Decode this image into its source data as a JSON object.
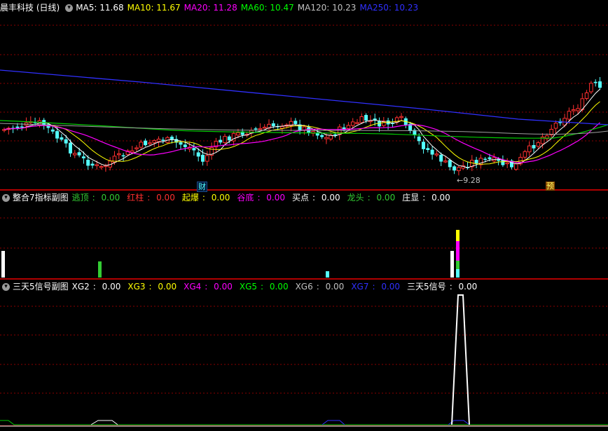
{
  "main": {
    "title": "晨丰科技 (日线)",
    "ma": [
      {
        "label": "MA5: 11.68",
        "color": "#ffffff"
      },
      {
        "label": "MA10: 11.67",
        "color": "#ffff00"
      },
      {
        "label": "MA20: 11.28",
        "color": "#ff00ff"
      },
      {
        "label": "MA60: 10.47",
        "color": "#00ff00"
      },
      {
        "label": "MA120: 10.23",
        "color": "#c0c0c0"
      },
      {
        "label": "MA250: 10.23",
        "color": "#3030ff"
      }
    ],
    "low_marker": "9.28",
    "badges": {
      "cai": "财",
      "yu": "预"
    },
    "colors": {
      "up": "#ff3030",
      "down": "#54ffff",
      "grid": "#8b0000",
      "border": "#b00000"
    }
  },
  "sub1": {
    "title": "整合7指标副图",
    "items": [
      {
        "name": "逃顶",
        "value": "0.00",
        "color": "#33cc33"
      },
      {
        "name": "红柱",
        "value": "0.00",
        "color": "#ff3030"
      },
      {
        "name": "起爆",
        "value": "0.00",
        "color": "#ffff00"
      },
      {
        "name": "谷底",
        "value": "0.00",
        "color": "#ff00ff"
      },
      {
        "name": "买点",
        "value": "0.00",
        "color": "#ffffff"
      },
      {
        "name": "龙头",
        "value": "0.00",
        "color": "#33cc33"
      },
      {
        "name": "庄显",
        "value": "0.00",
        "color": "#ffffff"
      }
    ]
  },
  "sub2": {
    "title": "三天5信号副图",
    "items": [
      {
        "name": "XG2",
        "value": "0.00",
        "color": "#ffffff"
      },
      {
        "name": "XG3",
        "value": "0.00",
        "color": "#ffff00"
      },
      {
        "name": "XG4",
        "value": "0.00",
        "color": "#ff00ff"
      },
      {
        "name": "XG5",
        "value": "0.00",
        "color": "#00ff00"
      },
      {
        "name": "XG6",
        "value": "0.00",
        "color": "#c0c0c0"
      },
      {
        "name": "XG7",
        "value": "0.00",
        "color": "#3030ff"
      },
      {
        "name": "三天5信号",
        "value": "0.00",
        "color": "#ffffff"
      }
    ]
  }
}
